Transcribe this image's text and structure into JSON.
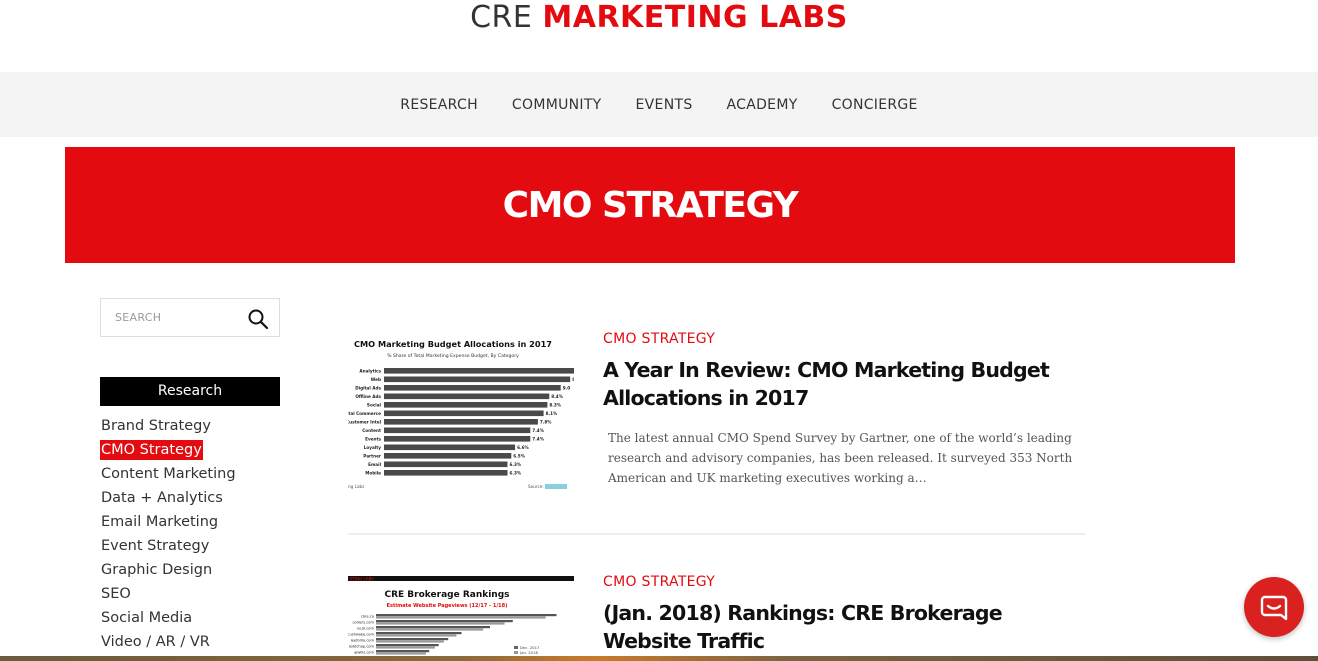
{
  "logo": {
    "part1": "CRE ",
    "part2": "MARKETING LABS"
  },
  "nav": {
    "items": [
      {
        "label": "RESEARCH"
      },
      {
        "label": "COMMUNITY"
      },
      {
        "label": "EVENTS"
      },
      {
        "label": "ACADEMY"
      },
      {
        "label": "CONCIERGE"
      }
    ]
  },
  "hero": {
    "title": "CMO STRATEGY"
  },
  "sidebar": {
    "search": {
      "placeholder": "SEARCH",
      "icon": "search-icon"
    },
    "heading": "Research",
    "categories": [
      {
        "label": "Brand Strategy",
        "active": false
      },
      {
        "label": "CMO Strategy",
        "active": true
      },
      {
        "label": "Content Marketing",
        "active": false
      },
      {
        "label": "Data + Analytics",
        "active": false
      },
      {
        "label": "Email Marketing",
        "active": false
      },
      {
        "label": "Event Strategy",
        "active": false
      },
      {
        "label": "Graphic Design",
        "active": false
      },
      {
        "label": "SEO",
        "active": false
      },
      {
        "label": "Social Media",
        "active": false
      },
      {
        "label": "Video / AR / VR",
        "active": false
      }
    ]
  },
  "posts": [
    {
      "category": "CMO STRATEGY",
      "title": "A Year In Review: CMO Marketing Budget Allocations in 2017",
      "excerpt": "The latest annual CMO Spend Survey by Gartner, one of the world’s leading research and advisory companies, has been released. It surveyed 353 North American and UK marketing executives working a…",
      "thumbnail": {
        "title": "CMO Marketing Budget Allocations in 2017",
        "subtitle": "% Share of Total Marketing Expense Budget, By Category",
        "footer_left": "ng Labs",
        "footer_right": "Source:",
        "rows": [
          {
            "label": "Analytics",
            "value": ""
          },
          {
            "label": "Web",
            "value": "9"
          },
          {
            "label": "Digital Ads",
            "value": "9.0"
          },
          {
            "label": "Offline Ads",
            "value": "8.4%"
          },
          {
            "label": "Social",
            "value": "8.3%"
          },
          {
            "label": "igital Commerce",
            "value": "8.1%"
          },
          {
            "label": "Customer Intel",
            "value": "7.8%"
          },
          {
            "label": "Content",
            "value": "7.4%"
          },
          {
            "label": "Events",
            "value": "7.4%"
          },
          {
            "label": "Loyalty",
            "value": "6.6%"
          },
          {
            "label": "Partner",
            "value": "6.5%"
          },
          {
            "label": "Email",
            "value": "6.3%"
          },
          {
            "label": "Mobile",
            "value": "6.3%"
          }
        ],
        "bar_fractions": [
          1,
          0.98,
          0.93,
          0.87,
          0.86,
          0.84,
          0.81,
          0.77,
          0.77,
          0.69,
          0.67,
          0.65,
          0.65
        ]
      }
    },
    {
      "category": "CMO STRATEGY",
      "title": "(Jan. 2018) Rankings: CRE Brokerage Website Traffic",
      "thumbnail": {
        "banner": "ETING LABS",
        "title": "CRE Brokerage Rankings",
        "subtitle": "Estimate Website Pageviews (12/17 - 1/18)",
        "legend": [
          "Dec. 2017",
          "Jan. 2018"
        ],
        "rows": [
          {
            "label": "cbre.co"
          },
          {
            "label": "colliers.com"
          },
          {
            "label": "us.jll.com"
          },
          {
            "label": "cushwake.com"
          },
          {
            "label": "leeforlio.com"
          },
          {
            "label": "sotdchop.com"
          },
          {
            "label": "ajwills.com"
          }
        ],
        "bar_fractions": [
          0.95,
          0.72,
          0.6,
          0.45,
          0.38,
          0.33,
          0.28
        ]
      }
    }
  ],
  "colors": {
    "accent": "#e30b0f",
    "nav_bg": "#f4f4f4"
  },
  "chat": {
    "icon": "chat-icon"
  }
}
